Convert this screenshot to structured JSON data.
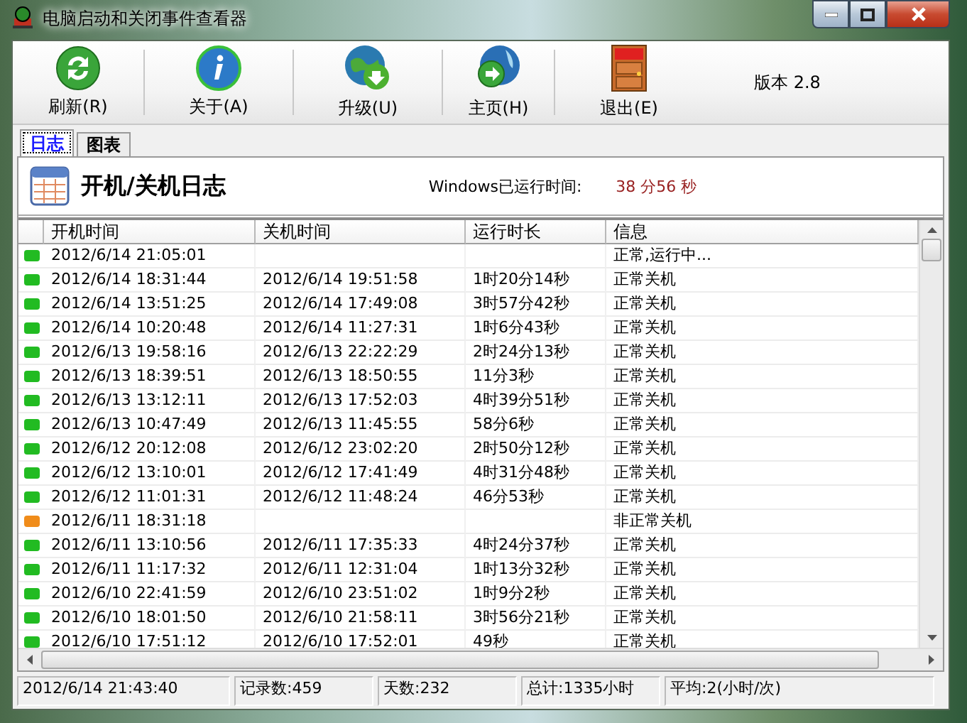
{
  "window": {
    "title": "电脑启动和关闭事件查看器"
  },
  "toolbar": {
    "buttons": [
      {
        "label": "刷新(R)",
        "kind": "refresh"
      },
      {
        "label": "关于(A)",
        "kind": "about"
      },
      {
        "label": "升级(U)",
        "kind": "upgrade"
      },
      {
        "label": "主页(H)",
        "kind": "home"
      },
      {
        "label": "退出(E)",
        "kind": "exit"
      }
    ],
    "version": "版本 2.8"
  },
  "tabs": [
    {
      "label": "日志",
      "selected": true
    },
    {
      "label": "图表",
      "selected": false
    }
  ],
  "header": {
    "title": "开机/关机日志",
    "uptime_label": "Windows已运行时间:",
    "uptime_value": "38 分56 秒"
  },
  "table": {
    "columns": [
      "开机时间",
      "关机时间",
      "运行时长",
      "信息"
    ],
    "rows": [
      {
        "color": "#22bb22",
        "cells": [
          "2012/6/14 21:05:01",
          "",
          "",
          "正常,运行中..."
        ]
      },
      {
        "color": "#22bb22",
        "cells": [
          "2012/6/14 18:31:44",
          "2012/6/14 19:51:58",
          "1时20分14秒",
          "正常关机"
        ]
      },
      {
        "color": "#22bb22",
        "cells": [
          "2012/6/14 13:51:25",
          "2012/6/14 17:49:08",
          "3时57分42秒",
          "正常关机"
        ]
      },
      {
        "color": "#22bb22",
        "cells": [
          "2012/6/14 10:20:48",
          "2012/6/14 11:27:31",
          "1时6分43秒",
          "正常关机"
        ]
      },
      {
        "color": "#22bb22",
        "cells": [
          "2012/6/13 19:58:16",
          "2012/6/13 22:22:29",
          "2时24分13秒",
          "正常关机"
        ]
      },
      {
        "color": "#22bb22",
        "cells": [
          "2012/6/13 18:39:51",
          "2012/6/13 18:50:55",
          "11分3秒",
          "正常关机"
        ]
      },
      {
        "color": "#22bb22",
        "cells": [
          "2012/6/13 13:12:11",
          "2012/6/13 17:52:03",
          "4时39分51秒",
          "正常关机"
        ]
      },
      {
        "color": "#22bb22",
        "cells": [
          "2012/6/13 10:47:49",
          "2012/6/13 11:45:55",
          "58分6秒",
          "正常关机"
        ]
      },
      {
        "color": "#22bb22",
        "cells": [
          "2012/6/12 20:12:08",
          "2012/6/12 23:02:20",
          "2时50分12秒",
          "正常关机"
        ]
      },
      {
        "color": "#22bb22",
        "cells": [
          "2012/6/12 13:10:01",
          "2012/6/12 17:41:49",
          "4时31分48秒",
          "正常关机"
        ]
      },
      {
        "color": "#22bb22",
        "cells": [
          "2012/6/12 11:01:31",
          "2012/6/12 11:48:24",
          "46分53秒",
          "正常关机"
        ]
      },
      {
        "color": "#f08c1a",
        "cells": [
          "2012/6/11 18:31:18",
          "",
          "",
          "非正常关机"
        ]
      },
      {
        "color": "#22bb22",
        "cells": [
          "2012/6/11 13:10:56",
          "2012/6/11 17:35:33",
          "4时24分37秒",
          "正常关机"
        ]
      },
      {
        "color": "#22bb22",
        "cells": [
          "2012/6/11 11:17:32",
          "2012/6/11 12:31:04",
          "1时13分32秒",
          "正常关机"
        ]
      },
      {
        "color": "#22bb22",
        "cells": [
          "2012/6/10 22:41:59",
          "2012/6/10 23:51:02",
          "1时9分2秒",
          "正常关机"
        ]
      },
      {
        "color": "#22bb22",
        "cells": [
          "2012/6/10 18:01:50",
          "2012/6/10 21:58:11",
          "3时56分21秒",
          "正常关机"
        ]
      },
      {
        "color": "#22bb22",
        "cells": [
          "2012/6/10 17:51:12",
          "2012/6/10 17:52:01",
          "49秒",
          "正常关机"
        ]
      }
    ]
  },
  "status_bar": [
    "2012/6/14 21:43:40",
    "记录数:459",
    "天数:232",
    "总计:1335小时",
    "平均:2(小时/次)"
  ]
}
